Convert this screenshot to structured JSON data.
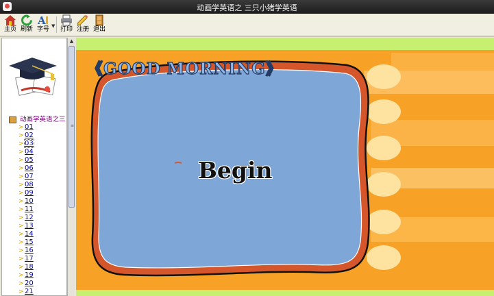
{
  "window": {
    "title": "动画学英语之 三只小猪学英语"
  },
  "toolbar": {
    "buttons": [
      {
        "label": "主页",
        "icon": "home-icon"
      },
      {
        "label": "刷新",
        "icon": "refresh-icon"
      },
      {
        "label": "字号",
        "icon": "font-size-icon"
      },
      {
        "label": "打印",
        "icon": "printer-icon"
      },
      {
        "label": "注册",
        "icon": "pencil-icon"
      },
      {
        "label": "退出",
        "icon": "exit-door-icon"
      }
    ]
  },
  "sidebar": {
    "root_label": "动画学英语之三",
    "selected": "03",
    "items": [
      "01",
      "02",
      "03",
      "04",
      "05",
      "06",
      "07",
      "08",
      "09",
      "10",
      "11",
      "12",
      "13",
      "14",
      "15",
      "16",
      "17",
      "18",
      "19",
      "20",
      "21"
    ]
  },
  "stage": {
    "title": "《GOOD MORNING》",
    "start_button": "Begin"
  },
  "colors": {
    "stage_orange": "#f7a226",
    "frame_blue": "#7ea6d6",
    "frame_rim": "#d4562a",
    "lime_band": "#c8f070",
    "link_blue": "#0000c0",
    "root_purple": "#800080"
  }
}
